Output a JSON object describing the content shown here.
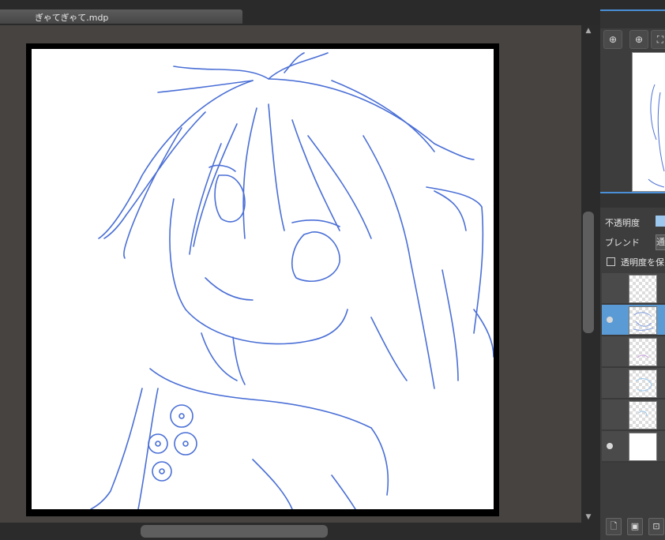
{
  "document": {
    "tab_title": "ぎゃてぎゃて.mdp"
  },
  "navigator": {
    "tools": [
      {
        "icon": "zoom-fit-icon",
        "glyph": "⊕"
      },
      {
        "icon": "zoom-in-icon",
        "glyph": "⊕"
      },
      {
        "icon": "fit-window-icon",
        "glyph": "⛶"
      }
    ]
  },
  "layers_panel": {
    "opacity_label": "不透明度",
    "blend_label": "ブレンド",
    "blend_value": "通",
    "protect_alpha_label": "透明度を保",
    "layers": [
      {
        "visible": false,
        "selected": false,
        "thumb": "transparent"
      },
      {
        "visible": true,
        "selected": true,
        "thumb": "transparent"
      },
      {
        "visible": false,
        "selected": false,
        "thumb": "transparent"
      },
      {
        "visible": false,
        "selected": false,
        "thumb": "transparent"
      },
      {
        "visible": false,
        "selected": false,
        "thumb": "transparent"
      },
      {
        "visible": true,
        "selected": false,
        "thumb": "white"
      }
    ],
    "footer_buttons": [
      {
        "icon": "new-layer-icon",
        "glyph": "🗋"
      },
      {
        "icon": "new-halftone-layer-icon",
        "glyph": "▣"
      },
      {
        "icon": "new-layer-folder-icon",
        "glyph": "⊡"
      }
    ]
  },
  "colors": {
    "line_art": "#4a6fd6",
    "accent": "#4a8fd8",
    "canvas_bg": "#474341"
  }
}
